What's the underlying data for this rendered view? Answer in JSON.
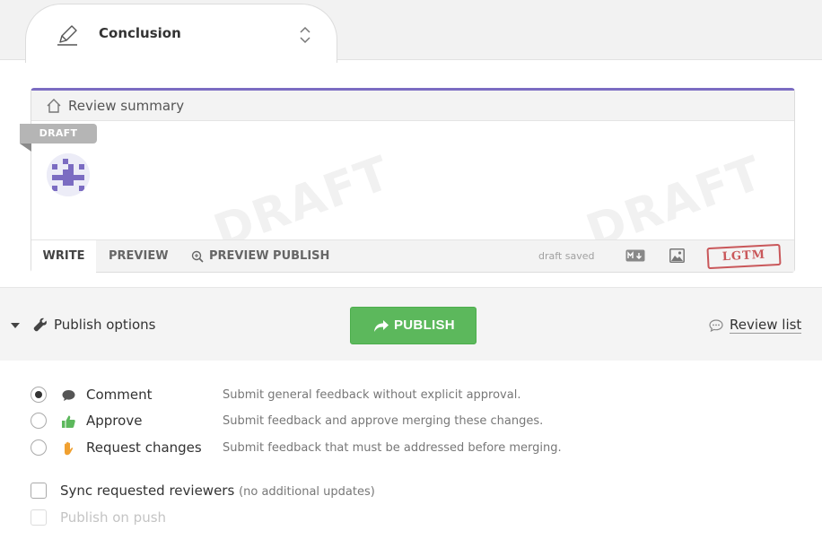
{
  "tab": {
    "title": "Conclusion"
  },
  "editor": {
    "header_title": "Review summary",
    "draft_ribbon": "DRAFT",
    "watermark": "DRAFT",
    "footer": {
      "write": "WRITE",
      "preview": "PREVIEW",
      "preview_publish": "PREVIEW PUBLISH",
      "status": "draft saved",
      "stamp": "LGTM"
    }
  },
  "options_bar": {
    "options_label": "Publish options",
    "publish_button": "PUBLISH",
    "review_list": "Review list"
  },
  "verdicts": [
    {
      "label": "Comment",
      "description": "Submit general feedback without explicit approval.",
      "checked": true,
      "icon": "comment-icon",
      "icon_color": "#555555"
    },
    {
      "label": "Approve",
      "description": "Submit feedback and approve merging these changes.",
      "checked": false,
      "icon": "thumbs-up-icon",
      "icon_color": "#5cb85c"
    },
    {
      "label": "Request changes",
      "description": "Submit feedback that must be addressed before merging.",
      "checked": false,
      "icon": "hand-icon",
      "icon_color": "#f0a030"
    }
  ],
  "settings": {
    "sync_label": "Sync requested reviewers",
    "sync_note": "(no additional updates)",
    "publish_on_push": "Publish on push"
  },
  "colors": {
    "accent": "#7b6cc2",
    "publish": "#5cb85c",
    "stamp": "#c9575a"
  }
}
